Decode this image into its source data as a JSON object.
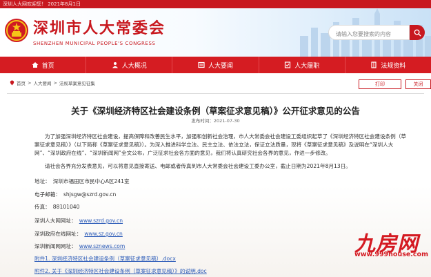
{
  "topbar": {
    "text": "深圳人大网欢迎您！ 2021年8月1日"
  },
  "header": {
    "title": "深圳市人大常委会",
    "subtitle": "SHENZHEN MUNICIPAL PEOPLE'S CONGRESS",
    "search_placeholder": "请输入您要搜索的内容",
    "brand_color": "#c8181f"
  },
  "nav": {
    "items": [
      {
        "label": "首页",
        "icon": "home-icon"
      },
      {
        "label": "人大概况",
        "icon": "people-icon"
      },
      {
        "label": "人大要闻",
        "icon": "news-icon"
      },
      {
        "label": "人大履职",
        "icon": "duty-icon"
      },
      {
        "label": "法规资料",
        "icon": "law-icon"
      }
    ]
  },
  "breadcrumb": {
    "items": [
      "首页",
      "人大要闻",
      "法规草案意见征集"
    ]
  },
  "actions": {
    "print_label": "打印",
    "close_label": "关闭"
  },
  "article": {
    "title": "关于《深圳经济特区社会建设条例（草案征求意见稿）》公开征求意见的公告",
    "date_label": "发布时间：2021-07-30",
    "para1": "为了加强深圳经济特区社会建设，提高保障和改善民生水平，加强和创新社会治理，市人大常委会社会建设工委组织起草了《深圳经济特区社会建设条例（草案征求意见稿）》（以下简称《草案征求意见稿》）。为深入推进科学立法、民主立法、依法立法，保证立法质量，现将《草案征求意见稿》及说明在“深圳人大网”、“深圳政府在线”、“深圳新闻网”全文公布，广泛征求社会各方面的意见，我们将认真研究社会各界的意见，作进一步修改。",
    "para2": "请社会各界充分发表意见，可以将意见直接寄送、电邮或者传真到市人大常委会社会建设工委办公室，截止日期为2021年8月13日。",
    "address_label": "地址：",
    "address_value": "深圳市福田区市民中心A区241室",
    "email_label": "电子邮箱：",
    "email_value": "shjsgw@szrd.gov.cn",
    "fax_label": "传真：",
    "fax_value": "88101040",
    "szrd_label": "深圳人大网网址：",
    "szrd_url": "www.szrd.gov.cn",
    "sz_label": "深圳政府在线网址：",
    "sz_url": "www.sz.gov.cn",
    "sznews_label": "深圳新闻网网址：",
    "sznews_url": "www.sznews.com",
    "attachment1": "附件1. 深圳经济特区社会建设条例（草案征求意见稿）.docx",
    "attachment2": "附件2. 关于《深圳经济特区社会建设条例（草案征求意见稿）》的说明.doc"
  },
  "watermark": {
    "brand": "九房网",
    "url": "www.999house.com",
    "color": "#d41a22"
  }
}
